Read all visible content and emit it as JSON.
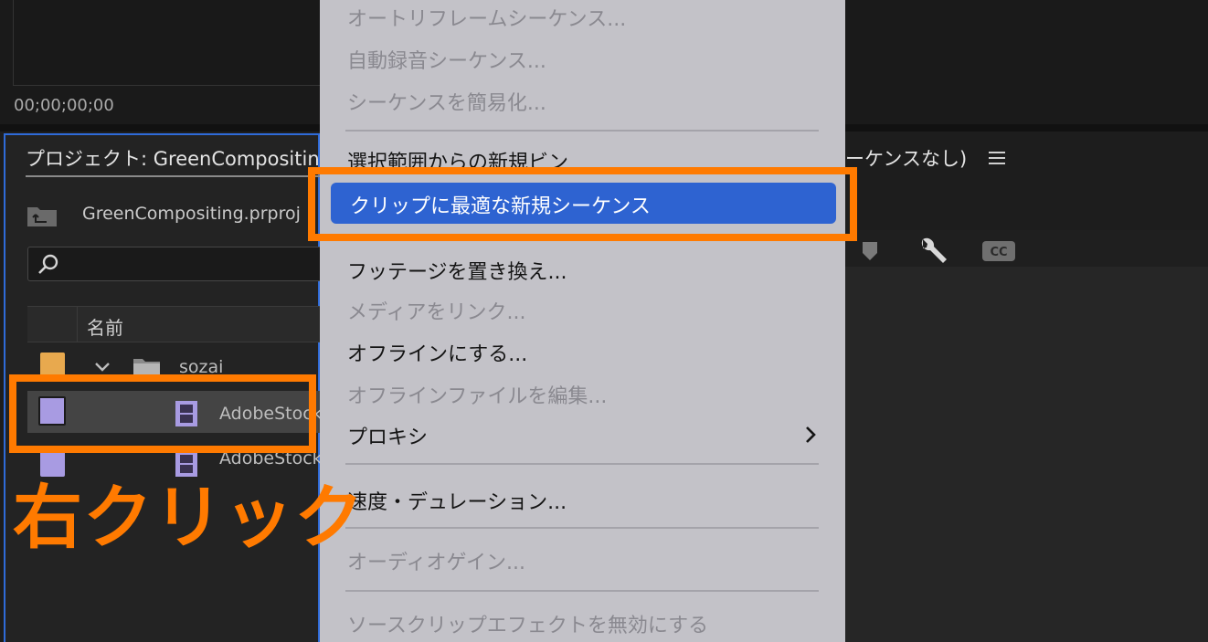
{
  "monitor": {
    "timecode": "00;00;00;00"
  },
  "project_panel": {
    "title": "プロジェクト: GreenCompositing",
    "file_name": "GreenCompositing.prproj",
    "search_placeholder": "",
    "column_name": "名前",
    "rows": [
      {
        "label": "sozai",
        "swatch_color": "#e8a94e",
        "kind": "folder"
      },
      {
        "label": "AdobeStock",
        "swatch_color": "#a89be2",
        "kind": "clip",
        "selected": true
      },
      {
        "label": "AdobeStock",
        "swatch_color": "#a89be2",
        "kind": "clip"
      }
    ]
  },
  "sequence_panel": {
    "title_fragment": "ーケンスなし)"
  },
  "context_menu": {
    "items": [
      {
        "label": "オートリフレームシーケンス...",
        "enabled": false
      },
      {
        "label": "自動録音シーケンス...",
        "enabled": false
      },
      {
        "label": "シーケンスを簡易化...",
        "enabled": false
      },
      {
        "label": "選択範囲からの新規ビン",
        "enabled": true
      },
      {
        "label": "クリップに最適な新規シーケンス",
        "enabled": true,
        "highlighted": true
      },
      {
        "label": "フッテージを置き換え...",
        "enabled": true
      },
      {
        "label": "メディアをリンク...",
        "enabled": false
      },
      {
        "label": "オフラインにする...",
        "enabled": true
      },
      {
        "label": "オフラインファイルを編集...",
        "enabled": false
      },
      {
        "label": "プロキシ",
        "enabled": true,
        "submenu": true
      },
      {
        "label": "速度・デュレーション...",
        "enabled": true
      },
      {
        "label": "オーディオゲイン...",
        "enabled": false
      },
      {
        "label": "ソースクリップエフェクトを無効にする",
        "enabled": false
      }
    ]
  },
  "annotation": {
    "text": "右クリック",
    "color": "#ff7a00"
  },
  "colors": {
    "accent": "#2e63d1",
    "panel_focus": "#2f6bd8"
  }
}
